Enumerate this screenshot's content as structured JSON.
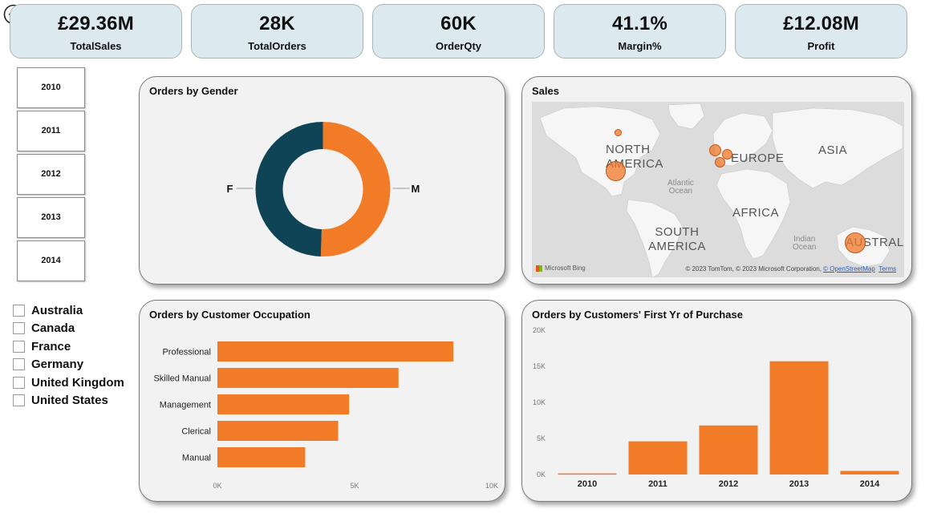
{
  "kpis": [
    {
      "value": "£29.36M",
      "label": "TotalSales"
    },
    {
      "value": "28K",
      "label": "TotalOrders"
    },
    {
      "value": "60K",
      "label": "OrderQty"
    },
    {
      "value": "41.1%",
      "label": "Margin%"
    },
    {
      "value": "£12.08M",
      "label": "Profit"
    }
  ],
  "years": [
    "2010",
    "2011",
    "2012",
    "2013",
    "2014"
  ],
  "countries": [
    "Australia",
    "Canada",
    "France",
    "Germany",
    "United Kingdom",
    "United States"
  ],
  "gender_panel": {
    "title": "Orders by Gender"
  },
  "sales_map": {
    "title": "Sales",
    "labels": {
      "north_america": [
        "NORTH",
        "AMERICA"
      ],
      "europe": "EUROPE",
      "asia": "ASIA",
      "africa": "AFRICA",
      "south_america": [
        "SOUTH",
        "AMERICA"
      ],
      "australia": "AUSTRALI",
      "atlantic": [
        "Atlantic",
        "Ocean"
      ],
      "indian": [
        "Indian",
        "Ocean"
      ]
    },
    "attribution": {
      "bing": "Microsoft Bing",
      "copyright": "© 2023 TomTom, © 2023 Microsoft Corporation,",
      "osm": "© OpenStreetMap",
      "terms": "Terms"
    }
  },
  "occupation_panel": {
    "title": "Orders by Customer Occupation"
  },
  "first_year_panel": {
    "title": "Orders by Customers' First Yr of Purchase"
  },
  "colors": {
    "orange": "#f27b28",
    "teal": "#0e4455",
    "kpi_bg": "#dce9ee",
    "panel_bg": "#f2f2f2"
  },
  "icons": {
    "back": "back-arrow-icon"
  },
  "chart_data": [
    {
      "type": "pie",
      "donut": true,
      "title": "Orders by Gender",
      "categories": [
        "F",
        "M"
      ],
      "values": [
        49.5,
        50.5
      ],
      "colors": [
        "#0e4455",
        "#f27b28"
      ]
    },
    {
      "type": "bar",
      "orientation": "horizontal",
      "title": "Orders by Customer Occupation",
      "categories": [
        "Professional",
        "Skilled Manual",
        "Management",
        "Clerical",
        "Manual"
      ],
      "values": [
        8600,
        6600,
        4800,
        4400,
        3200
      ],
      "xlim": [
        0,
        10000
      ],
      "xticks": [
        "0K",
        "5K",
        "10K"
      ],
      "color": "#f27b28"
    },
    {
      "type": "bar",
      "title": "Orders by Customers' First Yr of Purchase",
      "categories": [
        "2010",
        "2011",
        "2012",
        "2013",
        "2014"
      ],
      "values": [
        150,
        4600,
        6800,
        15700,
        500
      ],
      "ylim": [
        0,
        20000
      ],
      "yticks": [
        "0K",
        "5K",
        "10K",
        "15K",
        "20K"
      ],
      "color": "#f27b28"
    }
  ]
}
